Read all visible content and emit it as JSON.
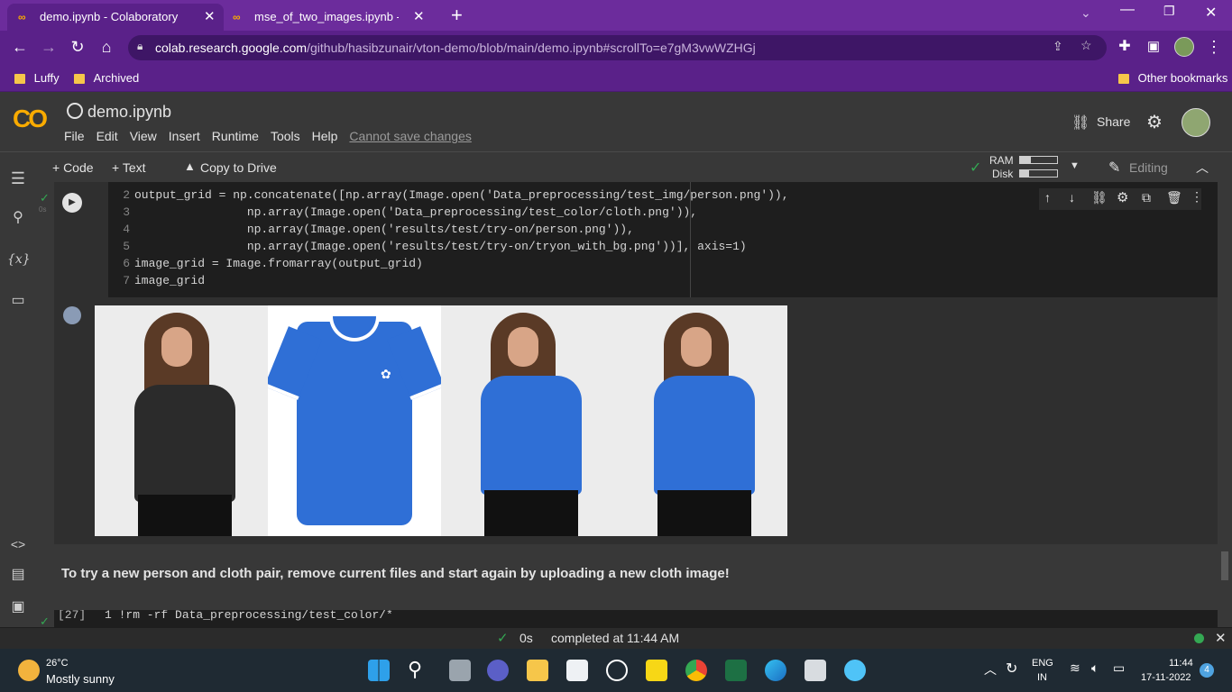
{
  "browser": {
    "tabs": [
      {
        "title": "demo.ipynb - Colaboratory",
        "active": true
      },
      {
        "title": "mse_of_two_images.ipynb - Colab",
        "active": false
      }
    ],
    "new_tab": "+",
    "url_host": "colab.research.google.com",
    "url_path": "/github/hasibzunair/vton-demo/blob/main/demo.ipynb#scrollTo=e7gM3vwWZHGj",
    "bookmarks": [
      "Luffy",
      "Archived"
    ],
    "other_bookmarks": "Other bookmarks"
  },
  "colab": {
    "logo": "CO",
    "notebook_title": "demo.ipynb",
    "menu": [
      "File",
      "Edit",
      "View",
      "Insert",
      "Runtime",
      "Tools",
      "Help"
    ],
    "cannot_save": "Cannot save changes",
    "share_label": "Share",
    "toolbar": {
      "code_label": "+ Code",
      "text_label": "+ Text",
      "copy_drive_label": "Copy to Drive",
      "ram_label": "RAM",
      "disk_label": "Disk",
      "editing_label": "Editing"
    }
  },
  "cell": {
    "exec_time": "0s",
    "code_lines": [
      {
        "num": "2",
        "text": "output_grid = np.concatenate([np.array(Image.open('Data_preprocessing/test_img/person.png')),"
      },
      {
        "num": "3",
        "text": "                np.array(Image.open('Data_preprocessing/test_color/cloth.png')),"
      },
      {
        "num": "4",
        "text": "                np.array(Image.open('results/test/try-on/person.png')),"
      },
      {
        "num": "5",
        "text": "                np.array(Image.open('results/test/try-on/tryon_with_bg.png'))], axis=1)"
      },
      {
        "num": "6",
        "text": "image_grid = Image.fromarray(output_grid)"
      },
      {
        "num": "7",
        "text": "image_grid"
      }
    ]
  },
  "markdown_text": "To try a new person and cloth pair, remove current files and start again by uploading a new cloth image!",
  "next_cell": {
    "exec_count": "[27]",
    "code": "1 !rm -rf Data_preprocessing/test_color/*"
  },
  "status": {
    "time": "0s",
    "completed": "completed at 11:44 AM"
  },
  "taskbar": {
    "temp": "26°C",
    "weather": "Mostly sunny",
    "lang_top": "ENG",
    "lang_bottom": "IN",
    "clock_time": "11:44",
    "clock_date": "17-11-2022",
    "notif_count": "4"
  },
  "colors": {
    "chrome_purple": "#6c2c9c",
    "colab_orange": "#f9ab00",
    "adidas_blue": "#2f6fd6",
    "green_check": "#34a853"
  }
}
